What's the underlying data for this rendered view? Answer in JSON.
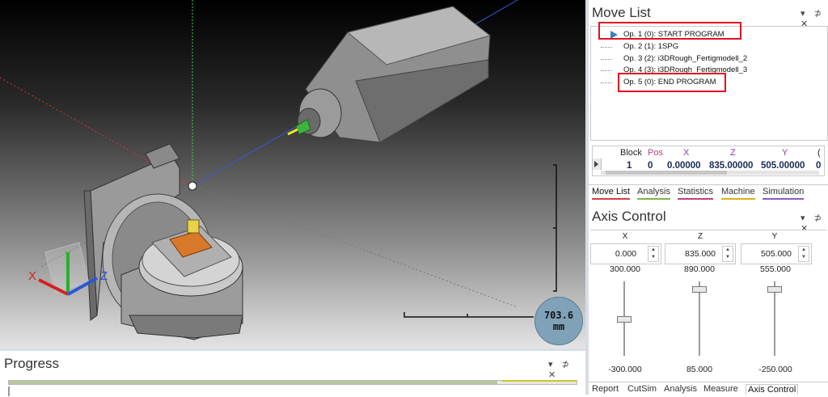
{
  "viewport": {
    "scale_value": "703.6",
    "scale_unit": "mm",
    "axis_labels": {
      "x": "X",
      "y": "Y",
      "z": "Z"
    }
  },
  "progress": {
    "title": "Progress",
    "panel_controls": "▾ ⊅ ✕",
    "value_fraction": 0.86
  },
  "move_list": {
    "title": "Move List",
    "panel_controls": "▾ ⊅ ✕",
    "operations": [
      "Op. 1 (0): START PROGRAM",
      "Op. 2 (1): 1SPG",
      "Op. 3 (2): i3DRough_Fertigmodell_2",
      "Op. 4 (3): i3DRough_Fertigmodell_3",
      "Op. 5 (0): END PROGRAM"
    ],
    "grid": {
      "headers": [
        "Block",
        "Pos",
        "X",
        "Z",
        "Y",
        "("
      ],
      "row": [
        "1",
        "0",
        "0.00000",
        "835.00000",
        "505.00000",
        "0"
      ]
    },
    "tabs": [
      "Move List",
      "Analysis",
      "Statistics",
      "Machine",
      "Simulation"
    ]
  },
  "axis_control": {
    "title": "Axis Control",
    "panel_controls": "▾ ⊅ ✕",
    "axes": [
      {
        "name": "X",
        "value": "0.000",
        "max": "300.000",
        "min": "-300.000"
      },
      {
        "name": "Z",
        "value": "835.000",
        "max": "890.000",
        "min": "85.000"
      },
      {
        "name": "Y",
        "value": "505.000",
        "max": "555.000",
        "min": "-250.000"
      }
    ],
    "tabs": [
      "Report",
      "CutSim",
      "Analysis",
      "Measure",
      "Axis Control"
    ]
  },
  "colors": {
    "red_highlight": "#e01020",
    "tab_accent_movelist": "#d04040",
    "tab_accent_analysis": "#7fb24a",
    "tab_accent_statistics": "#c04080",
    "tab_accent_machine": "#d8b020",
    "tab_accent_simulation": "#8a5cc0",
    "selection_blue": "#3b7fc9"
  }
}
